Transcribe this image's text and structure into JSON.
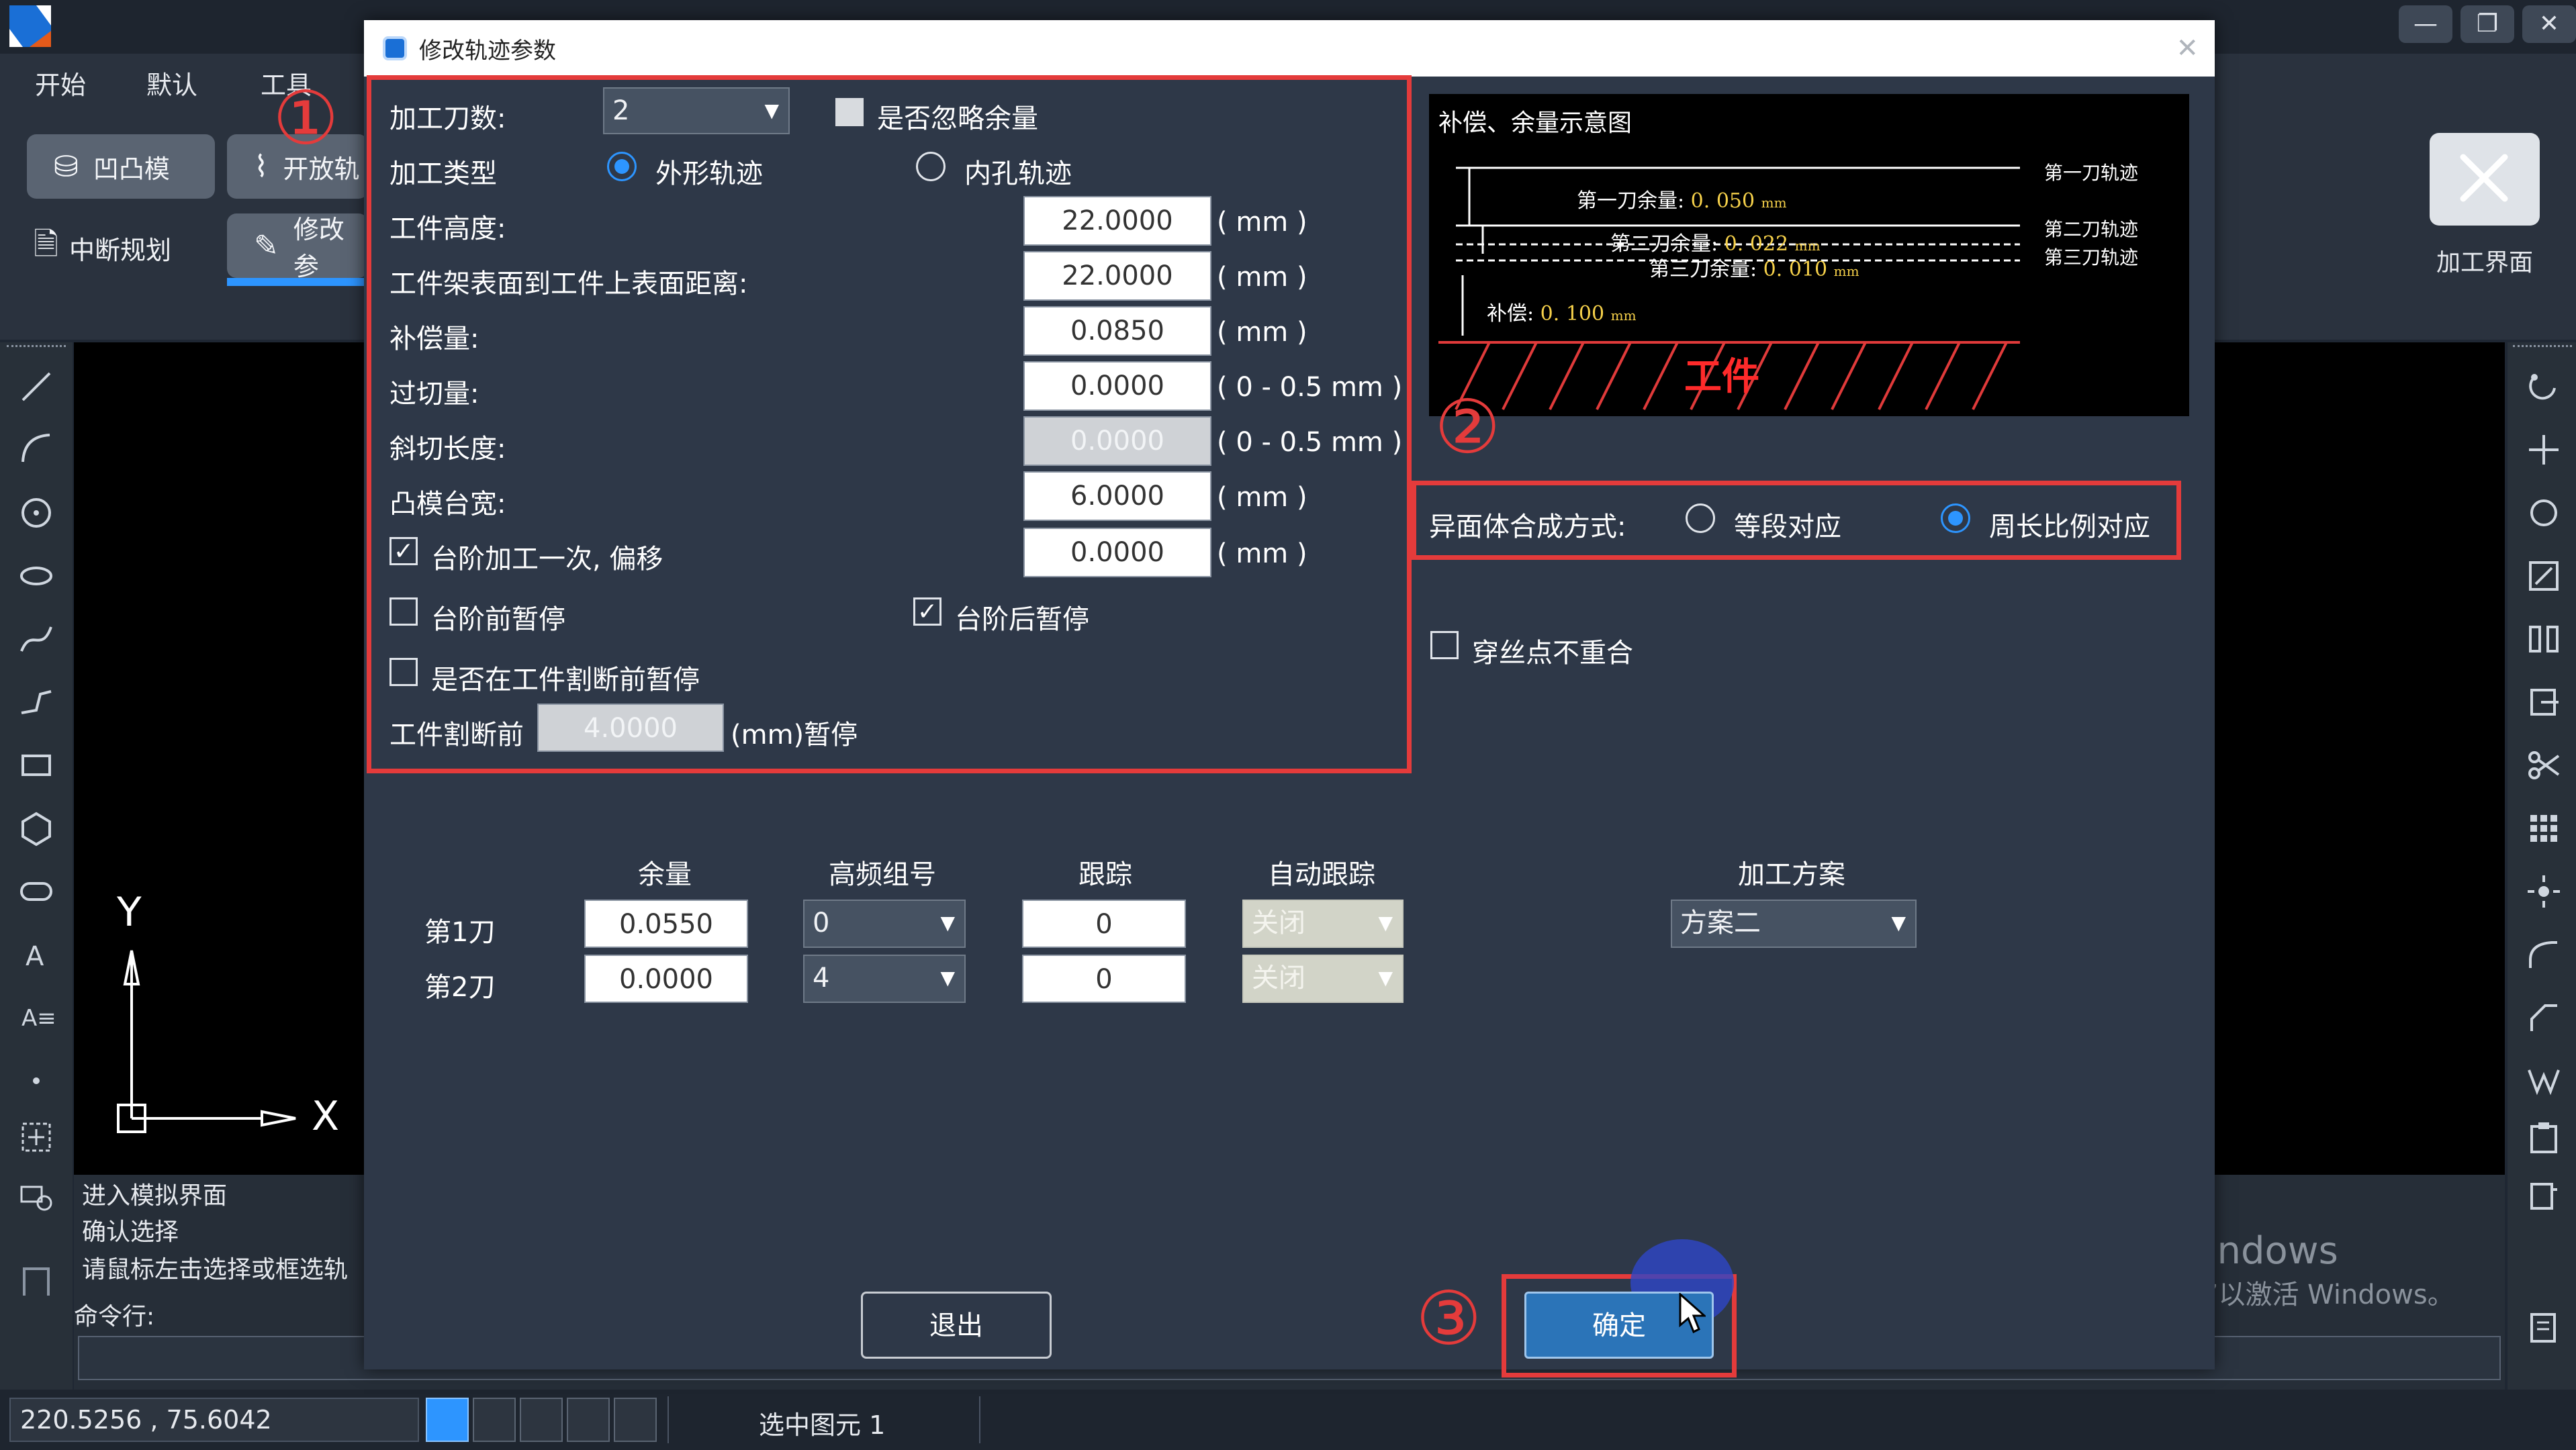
{
  "menu": [
    "开始",
    "默认",
    "工具"
  ],
  "ribbon": {
    "mold_button": "凹凸模",
    "open_button": "开放轨",
    "interrupt_button": "中断规划",
    "modify_button": "修改参",
    "process_ui_label": "加工界面"
  },
  "canvas": {
    "axis_y": "Y",
    "axis_x": "X"
  },
  "cmd": {
    "lines": [
      "进入模拟界面",
      "确认选择",
      "请鼠标左击选择或框选轨"
    ],
    "prompt": "命令行:"
  },
  "status": {
    "coords": "220.5256 , 75.6042",
    "selection": "选中图元  1"
  },
  "watermark": {
    "line1": "激活 Windows",
    "line2": "转到“设置”以激活 Windows。"
  },
  "dialog": {
    "title": "修改轨迹参数",
    "section1": {
      "badge": "①",
      "cut_count_label": "加工刀数:",
      "cut_count_value": "2",
      "ignore_allowance_label": "是否忽略余量",
      "process_type_label": "加工类型",
      "radio_outer": "外形轨迹",
      "radio_inner": "内孔轨迹",
      "rows": [
        {
          "label": "工件高度:",
          "value": "22.0000",
          "unit": "( mm )"
        },
        {
          "label": "工件架表面到工件上表面距离:",
          "value": "22.0000",
          "unit": "( mm )"
        },
        {
          "label": "补偿量:",
          "value": "0.0850",
          "unit": "( mm )"
        },
        {
          "label": "过切量:",
          "value": "0.0000",
          "unit": "( 0 - 0.5 mm )"
        },
        {
          "label": "斜切长度:",
          "value": "0.0000",
          "unit": "( 0 - 0.5 mm )"
        },
        {
          "label": "凸模台宽:",
          "value": "6.0000",
          "unit": "( mm )"
        }
      ],
      "step_once_label": "台阶加工一次, 偏移",
      "step_once_value": "0.0000",
      "step_once_unit": "( mm )",
      "pause_before_label": "台阶前暂停",
      "pause_after_label": "台阶后暂停",
      "pause_cut_label": "是否在工件割断前暂停",
      "cut_before_label": "工件割断前",
      "cut_before_value": "4.0000",
      "cut_before_unit": "(mm)暂停"
    },
    "preview": {
      "title": "补偿、余量示意图",
      "first_allow_label": "第一刀余量:",
      "first_allow_value": "0. 050",
      "second_allow_label": "第二刀余量:",
      "second_allow_value": "0. 022",
      "third_allow_label": "第三刀余量:",
      "third_allow_value": "0. 010",
      "comp_label": "补偿:",
      "comp_value": "0. 100",
      "unit": "mm",
      "track1": "第一刀轨迹",
      "track2": "第二刀轨迹",
      "track3": "第三刀轨迹",
      "workpiece": "工件"
    },
    "section2": {
      "badge": "②",
      "label": "异面体合成方式:",
      "radio_equal": "等段对应",
      "radio_ratio": "周长比例对应"
    },
    "wire_label": "穿丝点不重合",
    "table": {
      "headers": [
        "余量",
        "高频组号",
        "跟踪",
        "自动跟踪"
      ],
      "rows": [
        {
          "name": "第1刀",
          "allowance": "0.0550",
          "group": "0",
          "track": "0",
          "auto": "关闭"
        },
        {
          "name": "第2刀",
          "allowance": "0.0000",
          "group": "4",
          "track": "0",
          "auto": "关闭"
        }
      ],
      "plan_label": "加工方案",
      "plan_value": "方案二"
    },
    "exit_button": "退出",
    "ok_button": "确定",
    "badge3": "③"
  }
}
